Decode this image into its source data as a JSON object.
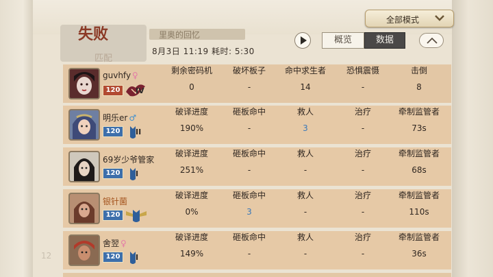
{
  "mode_dropdown": {
    "label": "全部模式"
  },
  "header": {
    "result": "失败",
    "mode": "匹配",
    "map_banner": "里奥的回忆",
    "datetime": "8月3日  11:19 耗时: 5:30"
  },
  "tabs": {
    "overview": "概览",
    "data": "数据"
  },
  "hunter": {
    "name": "guvhfy",
    "gender": "♀",
    "level": "120",
    "rank": "IV",
    "columns": [
      {
        "header": "剩余密码机",
        "value": "0"
      },
      {
        "header": "破坏板子",
        "value": "-"
      },
      {
        "header": "命中求生者",
        "value": "14"
      },
      {
        "header": "恐惧震慑",
        "value": "-"
      },
      {
        "header": "击倒",
        "value": "8"
      }
    ]
  },
  "survivors": [
    {
      "name": "明乐er",
      "gender": "♂",
      "level": "120",
      "rank": "II",
      "columns": [
        {
          "header": "破译进度",
          "value": "190%"
        },
        {
          "header": "砸板命中",
          "value": "-"
        },
        {
          "header": "救人",
          "value": "3"
        },
        {
          "header": "治疗",
          "value": "-"
        },
        {
          "header": "牵制监管者",
          "value": "73s"
        }
      ]
    },
    {
      "name": "69岁少爷管家",
      "gender": "",
      "level": "120",
      "rank": "I",
      "columns": [
        {
          "header": "破译进度",
          "value": "251%"
        },
        {
          "header": "砸板命中",
          "value": "-"
        },
        {
          "header": "救人",
          "value": "-"
        },
        {
          "header": "治疗",
          "value": "-"
        },
        {
          "header": "牵制监管者",
          "value": "68s"
        }
      ]
    },
    {
      "name": "银针菌",
      "gender": "",
      "level": "120",
      "rank": "",
      "columns": [
        {
          "header": "破译进度",
          "value": "0%"
        },
        {
          "header": "砸板命中",
          "value": "3"
        },
        {
          "header": "救人",
          "value": "-"
        },
        {
          "header": "治疗",
          "value": "-"
        },
        {
          "header": "牵制监管者",
          "value": "110s"
        }
      ]
    },
    {
      "name": "舍翌",
      "gender": "♀",
      "level": "120",
      "rank": "I",
      "columns": [
        {
          "header": "破译进度",
          "value": "149%"
        },
        {
          "header": "砸板命中",
          "value": "-"
        },
        {
          "header": "救人",
          "value": "-"
        },
        {
          "header": "治疗",
          "value": "-"
        },
        {
          "header": "牵制监管者",
          "value": "36s"
        }
      ]
    }
  ],
  "page_number": "12",
  "colors": {
    "accent_red": "#b24a31",
    "accent_blue": "#3d6fab",
    "row_bg": "#e6c9a6"
  }
}
